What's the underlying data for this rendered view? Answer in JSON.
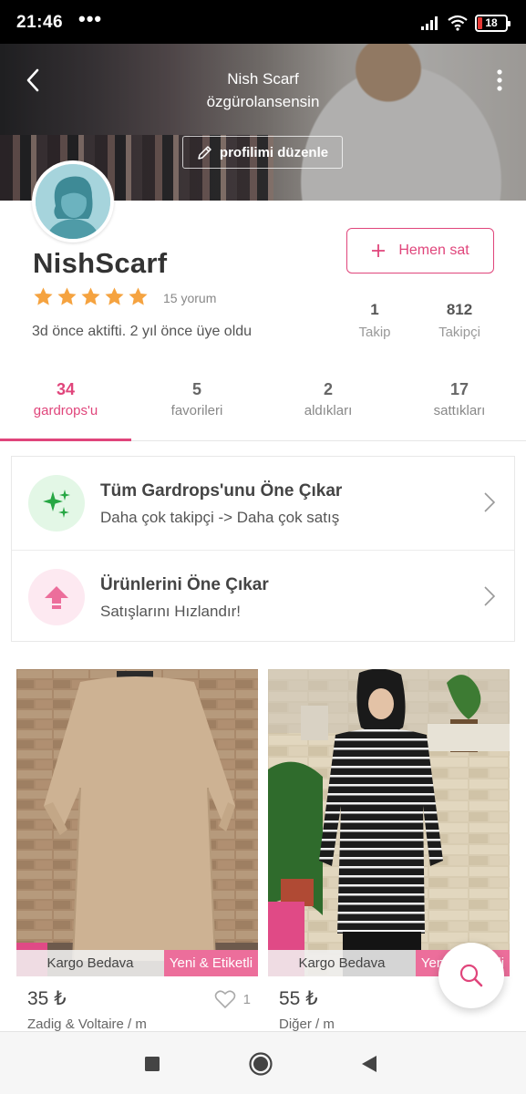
{
  "status_bar": {
    "time": "21:46",
    "dots": "•••",
    "battery": "18",
    "icons": [
      "signal-icon",
      "wifi-icon",
      "battery-icon"
    ]
  },
  "header": {
    "back_icon": "back-arrow-icon",
    "name": "Nish Scarf",
    "handle": "özgürolansensin",
    "edit_button": "profilimi düzenle",
    "edit_icon": "pencil-icon",
    "more_icon": "more-vertical-icon"
  },
  "profile": {
    "username": "NishScarf",
    "rating_stars": 5,
    "reviews": "15 yorum",
    "activity": "3d önce aktifti. 2 yıl önce üye oldu",
    "sell_button": "Hemen sat",
    "stats": [
      {
        "value": "1",
        "label": "Takip"
      },
      {
        "value": "812",
        "label": "Takipçi"
      }
    ]
  },
  "tabs": [
    {
      "count": "34",
      "label": "gardrops'u",
      "active": true
    },
    {
      "count": "5",
      "label": "favorileri",
      "active": false
    },
    {
      "count": "2",
      "label": "aldıkları",
      "active": false
    },
    {
      "count": "17",
      "label": "sattıkları",
      "active": false
    }
  ],
  "promos": [
    {
      "title": "Tüm Gardrops'unu Öne Çıkar",
      "subtitle": "Daha çok takipçi -> Daha çok satış",
      "icon": "sparkle-icon",
      "icon_color": "#27a744",
      "bg": "#e3f7e6"
    },
    {
      "title": "Ürünlerini Öne Çıkar",
      "subtitle": "Satışlarını Hızlandır!",
      "icon": "boost-arrow-icon",
      "icon_color": "#ec6e9b",
      "bg": "#fde9f1"
    }
  ],
  "products": [
    {
      "cargo_label": "Kargo Bedava",
      "new_label": "Yeni & Etiketli",
      "price": "35 ₺",
      "brand": "Zadig & Voltaire /  m",
      "likes": "1"
    },
    {
      "cargo_label": "Kargo Bedava",
      "new_label": "Yeni & Etiketli",
      "price": "55 ₺",
      "brand": "Diğer /  m",
      "likes": ""
    }
  ],
  "colors": {
    "accent": "#e0457b",
    "green": "#27a744"
  },
  "nav": {
    "icons": [
      "recents-square-icon",
      "home-circle-icon",
      "back-triangle-icon"
    ]
  }
}
